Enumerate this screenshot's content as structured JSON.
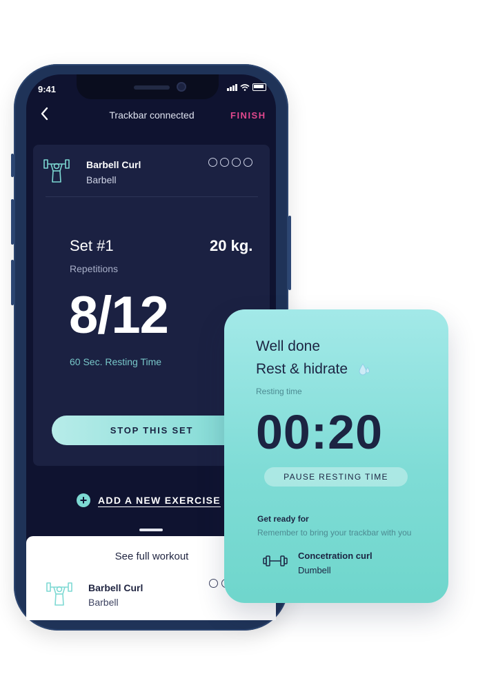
{
  "status_bar": {
    "time": "9:41"
  },
  "nav": {
    "title": "Trackbar connected",
    "finish_label": "FINISH"
  },
  "exercise": {
    "name": "Barbell Curl",
    "equipment": "Barbell"
  },
  "set": {
    "label": "Set #1",
    "weight": "20 kg.",
    "reps_label": "Repetitions",
    "reps_value": "8/12",
    "rest_note": "60 Sec. Resting Time",
    "stop_label": "STOP THIS SET"
  },
  "add_exercise_label": "ADD A NEW EXERCISE",
  "sheet": {
    "title": "See full workout",
    "exercise_name": "Barbell Curl",
    "exercise_equipment": "Barbell"
  },
  "rest_card": {
    "line1": "Well done",
    "line2": "Rest & hidrate",
    "resting_label": "Resting time",
    "timer": "00:20",
    "pause_label": "PAUSE RESTING TIME",
    "ready_label": "Get ready for",
    "ready_note": "Remember to bring your trackbar with you",
    "next_name": "Concetration curl",
    "next_equipment": "Dumbell"
  },
  "colors": {
    "screen_bg": "#0f1330",
    "card_bg": "#1b2142",
    "accent_teal": "#7dd9d3",
    "finish_pink": "#e0488d",
    "phone_frame": "#1f3358"
  },
  "icons": [
    "back-chevron-icon",
    "barbell-curl-icon",
    "plus-circle-icon",
    "water-drop-icon",
    "dumbbell-icon",
    "signal-icon",
    "wifi-icon",
    "battery-icon"
  ]
}
